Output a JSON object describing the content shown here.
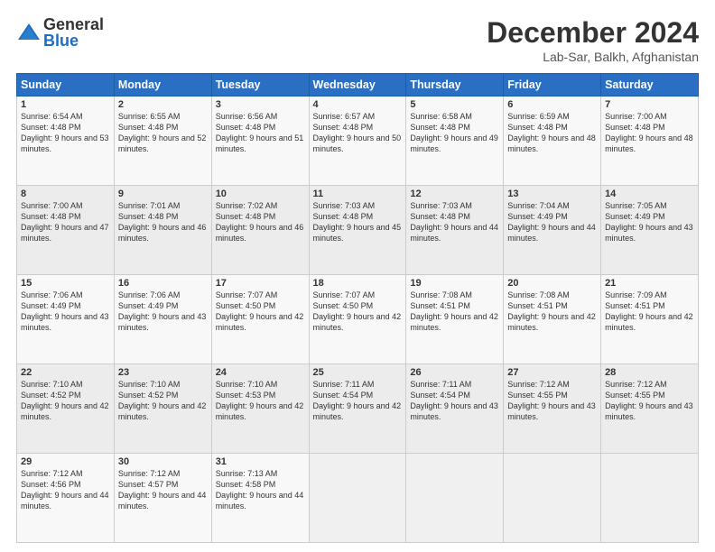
{
  "header": {
    "logo_general": "General",
    "logo_blue": "Blue",
    "month_title": "December 2024",
    "location": "Lab-Sar, Balkh, Afghanistan"
  },
  "days_of_week": [
    "Sunday",
    "Monday",
    "Tuesday",
    "Wednesday",
    "Thursday",
    "Friday",
    "Saturday"
  ],
  "weeks": [
    [
      {
        "day": "1",
        "sunrise": "6:54 AM",
        "sunset": "4:48 PM",
        "daylight": "9 hours and 53 minutes."
      },
      {
        "day": "2",
        "sunrise": "6:55 AM",
        "sunset": "4:48 PM",
        "daylight": "9 hours and 52 minutes."
      },
      {
        "day": "3",
        "sunrise": "6:56 AM",
        "sunset": "4:48 PM",
        "daylight": "9 hours and 51 minutes."
      },
      {
        "day": "4",
        "sunrise": "6:57 AM",
        "sunset": "4:48 PM",
        "daylight": "9 hours and 50 minutes."
      },
      {
        "day": "5",
        "sunrise": "6:58 AM",
        "sunset": "4:48 PM",
        "daylight": "9 hours and 49 minutes."
      },
      {
        "day": "6",
        "sunrise": "6:59 AM",
        "sunset": "4:48 PM",
        "daylight": "9 hours and 48 minutes."
      },
      {
        "day": "7",
        "sunrise": "7:00 AM",
        "sunset": "4:48 PM",
        "daylight": "9 hours and 48 minutes."
      }
    ],
    [
      {
        "day": "8",
        "sunrise": "7:00 AM",
        "sunset": "4:48 PM",
        "daylight": "9 hours and 47 minutes."
      },
      {
        "day": "9",
        "sunrise": "7:01 AM",
        "sunset": "4:48 PM",
        "daylight": "9 hours and 46 minutes."
      },
      {
        "day": "10",
        "sunrise": "7:02 AM",
        "sunset": "4:48 PM",
        "daylight": "9 hours and 46 minutes."
      },
      {
        "day": "11",
        "sunrise": "7:03 AM",
        "sunset": "4:48 PM",
        "daylight": "9 hours and 45 minutes."
      },
      {
        "day": "12",
        "sunrise": "7:03 AM",
        "sunset": "4:48 PM",
        "daylight": "9 hours and 44 minutes."
      },
      {
        "day": "13",
        "sunrise": "7:04 AM",
        "sunset": "4:49 PM",
        "daylight": "9 hours and 44 minutes."
      },
      {
        "day": "14",
        "sunrise": "7:05 AM",
        "sunset": "4:49 PM",
        "daylight": "9 hours and 43 minutes."
      }
    ],
    [
      {
        "day": "15",
        "sunrise": "7:06 AM",
        "sunset": "4:49 PM",
        "daylight": "9 hours and 43 minutes."
      },
      {
        "day": "16",
        "sunrise": "7:06 AM",
        "sunset": "4:49 PM",
        "daylight": "9 hours and 43 minutes."
      },
      {
        "day": "17",
        "sunrise": "7:07 AM",
        "sunset": "4:50 PM",
        "daylight": "9 hours and 42 minutes."
      },
      {
        "day": "18",
        "sunrise": "7:07 AM",
        "sunset": "4:50 PM",
        "daylight": "9 hours and 42 minutes."
      },
      {
        "day": "19",
        "sunrise": "7:08 AM",
        "sunset": "4:51 PM",
        "daylight": "9 hours and 42 minutes."
      },
      {
        "day": "20",
        "sunrise": "7:08 AM",
        "sunset": "4:51 PM",
        "daylight": "9 hours and 42 minutes."
      },
      {
        "day": "21",
        "sunrise": "7:09 AM",
        "sunset": "4:51 PM",
        "daylight": "9 hours and 42 minutes."
      }
    ],
    [
      {
        "day": "22",
        "sunrise": "7:10 AM",
        "sunset": "4:52 PM",
        "daylight": "9 hours and 42 minutes."
      },
      {
        "day": "23",
        "sunrise": "7:10 AM",
        "sunset": "4:52 PM",
        "daylight": "9 hours and 42 minutes."
      },
      {
        "day": "24",
        "sunrise": "7:10 AM",
        "sunset": "4:53 PM",
        "daylight": "9 hours and 42 minutes."
      },
      {
        "day": "25",
        "sunrise": "7:11 AM",
        "sunset": "4:54 PM",
        "daylight": "9 hours and 42 minutes."
      },
      {
        "day": "26",
        "sunrise": "7:11 AM",
        "sunset": "4:54 PM",
        "daylight": "9 hours and 43 minutes."
      },
      {
        "day": "27",
        "sunrise": "7:12 AM",
        "sunset": "4:55 PM",
        "daylight": "9 hours and 43 minutes."
      },
      {
        "day": "28",
        "sunrise": "7:12 AM",
        "sunset": "4:55 PM",
        "daylight": "9 hours and 43 minutes."
      }
    ],
    [
      {
        "day": "29",
        "sunrise": "7:12 AM",
        "sunset": "4:56 PM",
        "daylight": "9 hours and 44 minutes."
      },
      {
        "day": "30",
        "sunrise": "7:12 AM",
        "sunset": "4:57 PM",
        "daylight": "9 hours and 44 minutes."
      },
      {
        "day": "31",
        "sunrise": "7:13 AM",
        "sunset": "4:58 PM",
        "daylight": "9 hours and 44 minutes."
      },
      null,
      null,
      null,
      null
    ]
  ]
}
